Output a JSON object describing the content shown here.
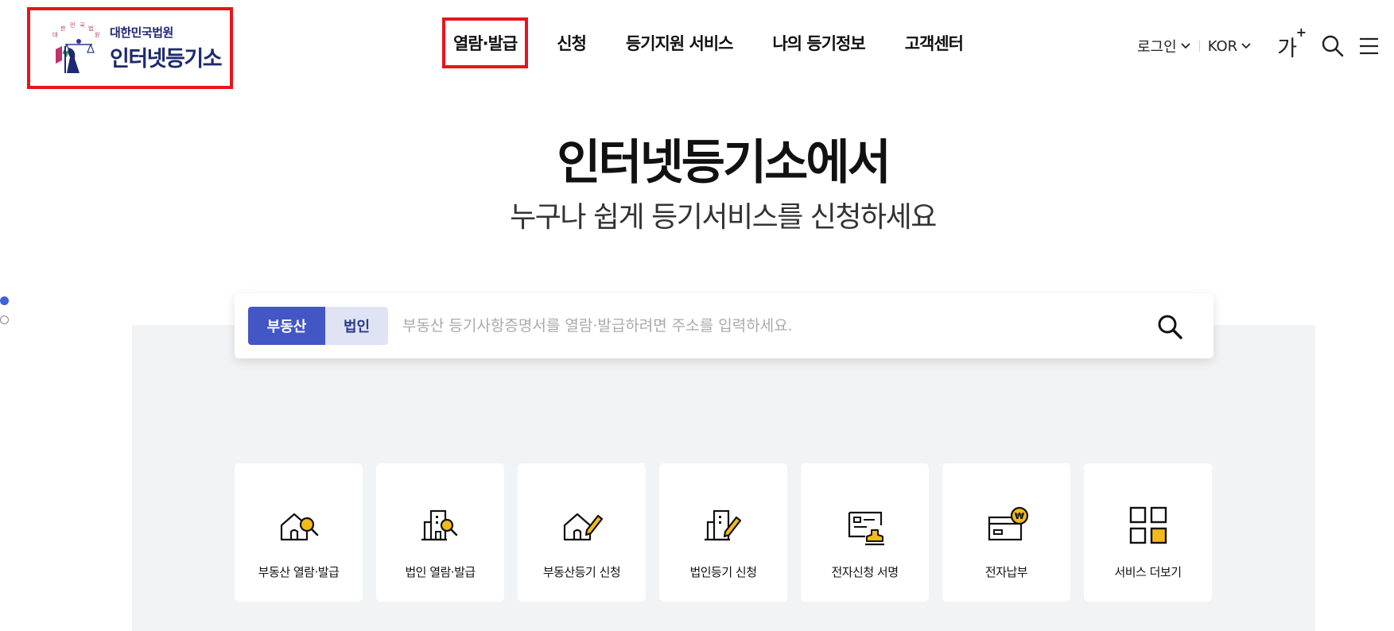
{
  "header": {
    "logo_sub": "대한민국법원",
    "logo_main": "인터넷등기소",
    "nav": [
      {
        "label": "열람·발급"
      },
      {
        "label": "신청"
      },
      {
        "label": "등기지원 서비스"
      },
      {
        "label": "나의 등기정보"
      },
      {
        "label": "고객센터"
      }
    ],
    "login_label": "로그인",
    "lang_label": "KOR",
    "font_size_label": "가",
    "font_size_plus": "+"
  },
  "hero": {
    "title": "인터넷등기소에서",
    "subtitle": "누구나 쉽게 등기서비스를 신청하세요"
  },
  "search": {
    "tab_realestate": "부동산",
    "tab_corp": "법인",
    "placeholder": "부동산 등기사항증명서를 열람·발급하려면 주소를 입력하세요."
  },
  "services": [
    {
      "label": "부동산 열람·발급",
      "icon": "house-search-icon"
    },
    {
      "label": "법인 열람·발급",
      "icon": "building-search-icon"
    },
    {
      "label": "부동산등기 신청",
      "icon": "house-edit-icon"
    },
    {
      "label": "법인등기 신청",
      "icon": "building-edit-icon"
    },
    {
      "label": "전자신청 서명",
      "icon": "document-stamp-icon"
    },
    {
      "label": "전자납부",
      "icon": "card-won-icon"
    },
    {
      "label": "서비스 더보기",
      "icon": "grid-more-icon"
    }
  ],
  "colors": {
    "accent": "#4356c5",
    "highlight": "#f3bb1a",
    "annotation_box": "#e8141c",
    "panel": "#f2f3f5"
  }
}
